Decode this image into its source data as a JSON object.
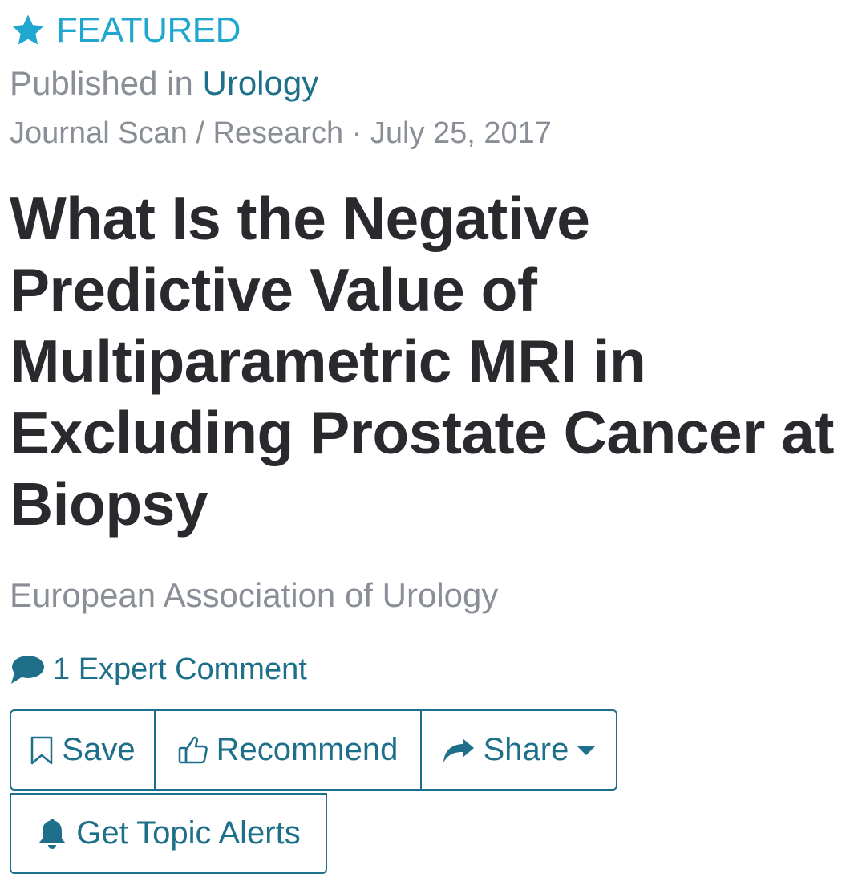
{
  "featured": {
    "label": "FEATURED",
    "icon": "star-icon",
    "color": "#1fa7cf"
  },
  "published": {
    "prefix": "Published in",
    "journal": "Urology"
  },
  "meta": {
    "category": "Journal Scan / Research",
    "separator": "·",
    "date": "July 25, 2017"
  },
  "article": {
    "title": "What Is the Negative Predictive Value of Multiparametric MRI in Excluding Prostate Cancer at Biopsy",
    "source": "European Association of Urology"
  },
  "comments": {
    "label": "1 Expert Comment",
    "icon": "speech-bubble-icon"
  },
  "actions": {
    "save": {
      "label": "Save",
      "icon": "bookmark-icon"
    },
    "recommend": {
      "label": "Recommend",
      "icon": "thumbs-up-icon"
    },
    "share": {
      "label": "Share",
      "icon": "share-arrow-icon"
    },
    "alerts": {
      "label": "Get Topic Alerts",
      "icon": "bell-icon"
    }
  },
  "colors": {
    "accent": "#1d6f8a",
    "muted": "#8a8e96",
    "title": "#2a2a2e"
  }
}
